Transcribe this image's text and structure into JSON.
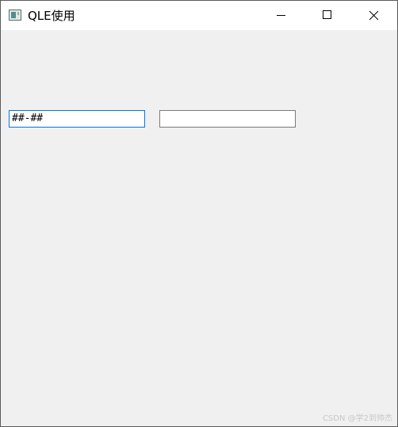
{
  "window": {
    "title": "QLE使用"
  },
  "fields": {
    "input_mask_value": "##-##",
    "second_value": ""
  },
  "watermark": "CSDN @学2到帅杰",
  "icons": {
    "app": "app-window-icon",
    "minimize": "minimize-icon",
    "maximize": "maximize-icon",
    "close": "close-icon"
  },
  "colors": {
    "focus_border": "#0078d7",
    "client_background": "#f0f0f0",
    "titlebar_background": "#ffffff"
  }
}
